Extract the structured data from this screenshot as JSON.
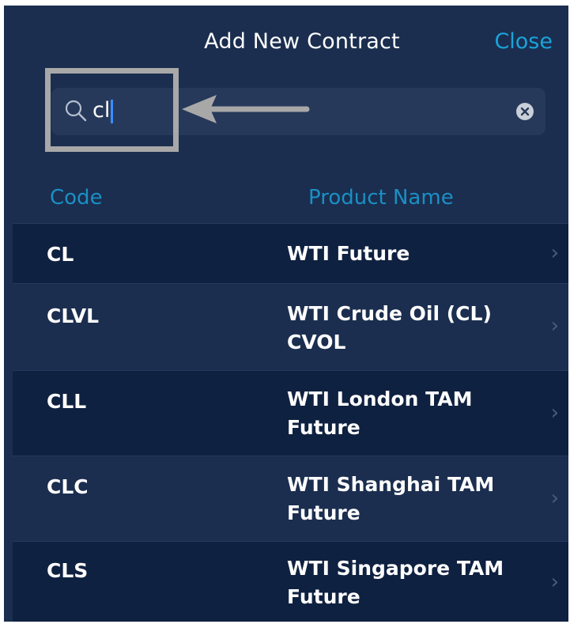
{
  "header": {
    "title": "Add New Contract",
    "close_label": "Close"
  },
  "search": {
    "value": "cl"
  },
  "columns": {
    "code": "Code",
    "product": "Product Name"
  },
  "contracts": [
    {
      "code": "CL",
      "name": "WTI Future"
    },
    {
      "code": "CLVL",
      "name": "WTI Crude Oil (CL) CVOL"
    },
    {
      "code": "CLL",
      "name": "WTI London TAM Future"
    },
    {
      "code": "CLC",
      "name": "WTI Shanghai TAM Future"
    },
    {
      "code": "CLS",
      "name": "WTI Singapore TAM Future"
    }
  ],
  "colors": {
    "background": "#1b2e4f",
    "row_dark": "#0f2140",
    "accent": "#1aa3d9",
    "annotation": "#a8a8a8"
  },
  "icons": {
    "search": "search-icon",
    "clear": "clear-icon",
    "chevron": "chevron-right-icon"
  }
}
